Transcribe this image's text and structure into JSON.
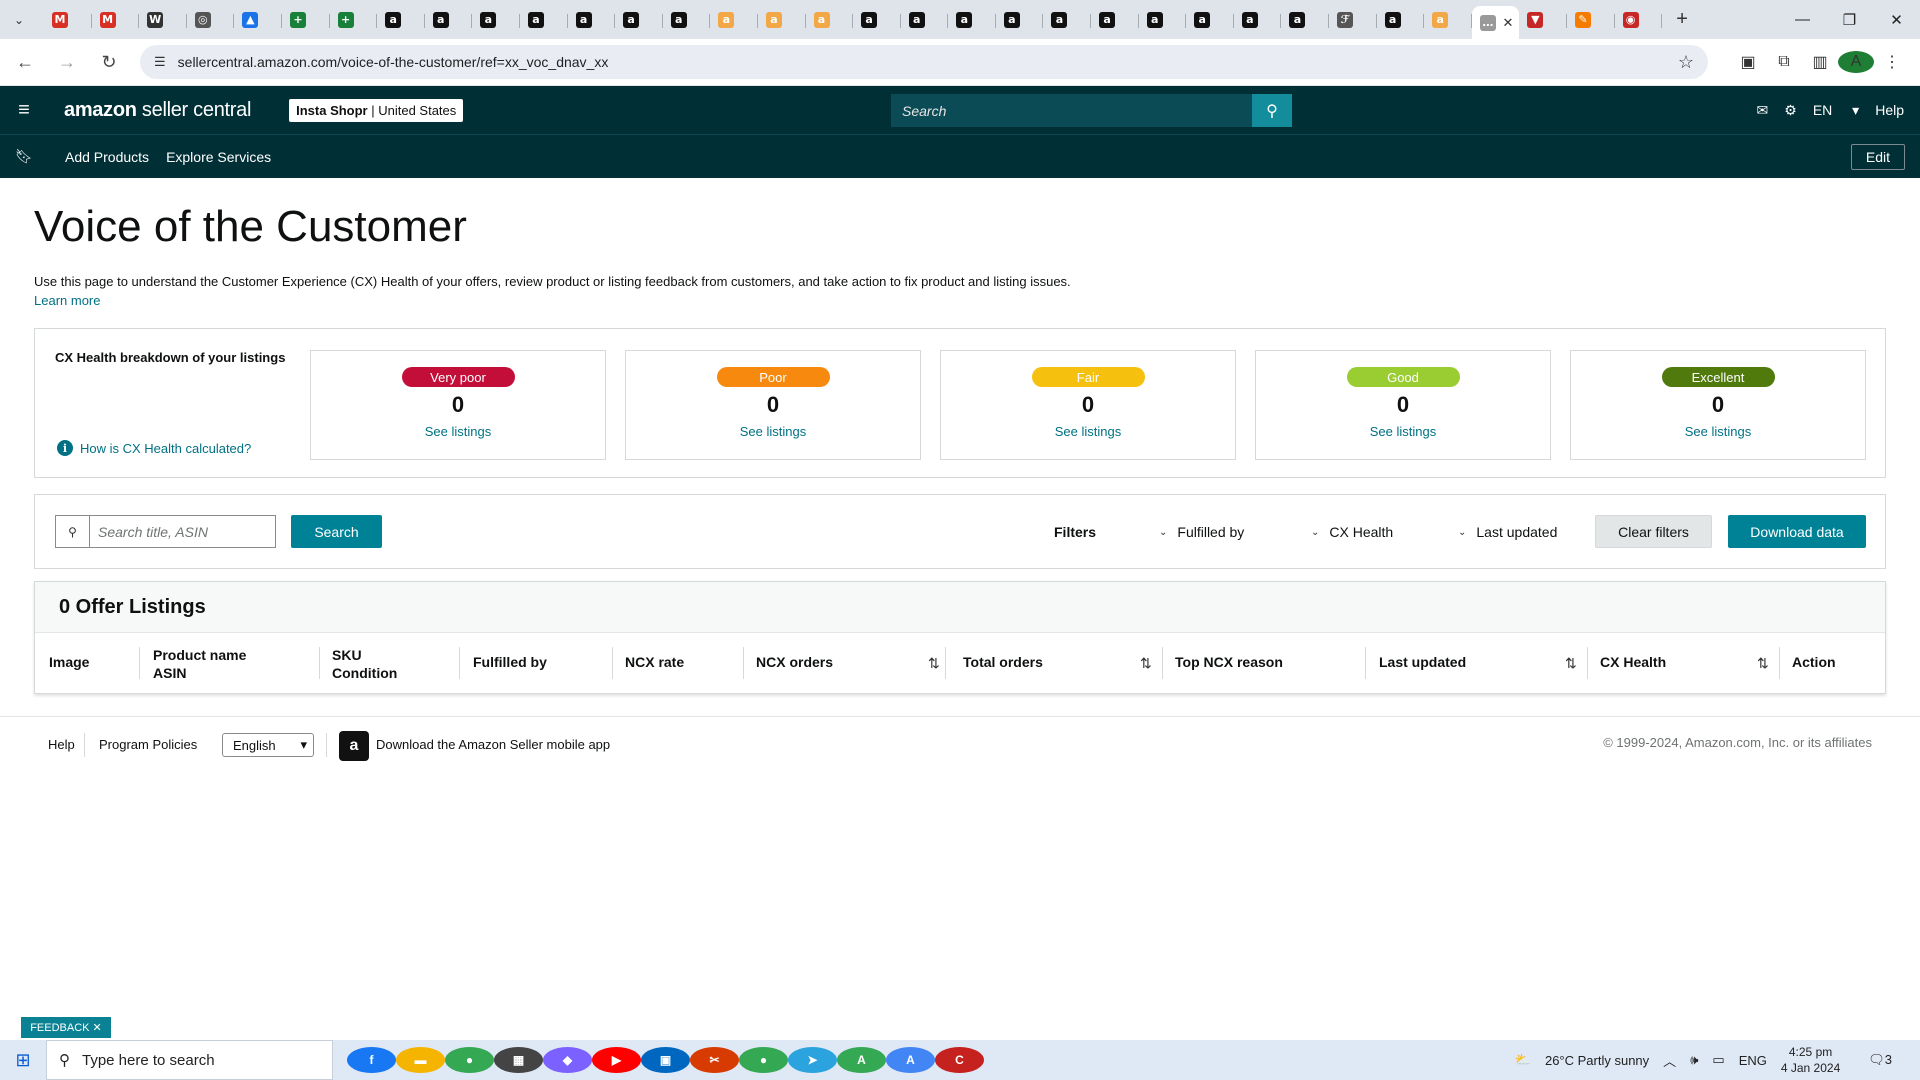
{
  "browser": {
    "url": "sellercentral.amazon.com/voice-of-the-customer/ref=xx_voc_dnav_xx",
    "tabs": [
      {
        "icon": "gmail-icon",
        "color": "#d93025",
        "glyph": "M"
      },
      {
        "icon": "gmail-icon",
        "color": "#d93025",
        "glyph": "M"
      },
      {
        "icon": "wix-icon",
        "color": "#333333",
        "glyph": "W"
      },
      {
        "icon": "globe-icon",
        "color": "#555555",
        "glyph": "◎"
      },
      {
        "icon": "drive-icon",
        "color": "#1a73e8",
        "glyph": "▲"
      },
      {
        "icon": "sheets-icon",
        "color": "#188038",
        "glyph": "+"
      },
      {
        "icon": "sheets-icon",
        "color": "#188038",
        "glyph": "+"
      },
      {
        "icon": "amazon-icon",
        "color": "#111111",
        "glyph": "a"
      },
      {
        "icon": "amazon-icon",
        "color": "#111111",
        "glyph": "a"
      },
      {
        "icon": "amazon-icon",
        "color": "#111111",
        "glyph": "a"
      },
      {
        "icon": "amazon-icon",
        "color": "#111111",
        "glyph": "a"
      },
      {
        "icon": "amazon-icon",
        "color": "#111111",
        "glyph": "a"
      },
      {
        "icon": "amazon-icon",
        "color": "#111111",
        "glyph": "a"
      },
      {
        "icon": "amazon-icon",
        "color": "#111111",
        "glyph": "a"
      },
      {
        "icon": "amazon-smile-icon",
        "color": "#f3a847",
        "glyph": "a"
      },
      {
        "icon": "amazon-smile-icon",
        "color": "#f3a847",
        "glyph": "a"
      },
      {
        "icon": "amazon-smile-icon",
        "color": "#f3a847",
        "glyph": "a"
      },
      {
        "icon": "amazon-icon",
        "color": "#111111",
        "glyph": "a"
      },
      {
        "icon": "amazon-icon",
        "color": "#111111",
        "glyph": "a"
      },
      {
        "icon": "amazon-icon",
        "color": "#111111",
        "glyph": "a"
      },
      {
        "icon": "amazon-icon",
        "color": "#111111",
        "glyph": "a"
      },
      {
        "icon": "amazon-icon",
        "color": "#111111",
        "glyph": "a"
      },
      {
        "icon": "amazon-icon",
        "color": "#111111",
        "glyph": "a"
      },
      {
        "icon": "amazon-icon",
        "color": "#111111",
        "glyph": "a"
      },
      {
        "icon": "amazon-icon",
        "color": "#111111",
        "glyph": "a"
      },
      {
        "icon": "amazon-icon",
        "color": "#111111",
        "glyph": "a"
      },
      {
        "icon": "amazon-icon",
        "color": "#111111",
        "glyph": "a"
      },
      {
        "icon": "script-icon",
        "color": "#555555",
        "glyph": "ℱ"
      },
      {
        "icon": "amazon-icon",
        "color": "#111111",
        "glyph": "a"
      },
      {
        "icon": "amazon-smile-icon",
        "color": "#f3a847",
        "glyph": "a"
      },
      {
        "icon": "loading-icon",
        "color": "#999999",
        "glyph": "…",
        "active": true
      },
      {
        "icon": "shield-icon",
        "color": "#c62828",
        "glyph": "▼"
      },
      {
        "icon": "pen-icon",
        "color": "#f57c00",
        "glyph": "✎"
      },
      {
        "icon": "record-icon",
        "color": "#c62828",
        "glyph": "◉"
      }
    ]
  },
  "header": {
    "logo_bold": "amazon",
    "logo_rest": " seller central",
    "merchant_name": "Insta Shopr",
    "merchant_region": " | United States",
    "search_placeholder": "Search",
    "lang": "EN",
    "help": "Help"
  },
  "subnav": {
    "items": [
      "Add Products",
      "Explore Services"
    ],
    "edit": "Edit"
  },
  "page": {
    "title": "Voice of the Customer",
    "description": "Use this page to understand the Customer Experience (CX) Health of your offers, review product or listing feedback from customers, and take action to fix product and listing issues.",
    "learn_more": "Learn more"
  },
  "cx_health": {
    "title": "CX Health breakdown of your listings",
    "how_link": "How is CX Health calculated?",
    "categories": [
      {
        "label": "Very poor",
        "count": "0",
        "link": "See listings",
        "color": "#c40e3a"
      },
      {
        "label": "Poor",
        "count": "0",
        "link": "See listings",
        "color": "#f78a0e"
      },
      {
        "label": "Fair",
        "count": "0",
        "link": "See listings",
        "color": "#f5c10e"
      },
      {
        "label": "Good",
        "count": "0",
        "link": "See listings",
        "color": "#9acd32"
      },
      {
        "label": "Excellent",
        "count": "0",
        "link": "See listings",
        "color": "#507a0b"
      }
    ]
  },
  "filters": {
    "search_placeholder": "Search title, ASIN",
    "search_button": "Search",
    "filters_label": "Filters",
    "dropdowns": [
      "Fulfilled by",
      "CX Health",
      "Last updated"
    ],
    "clear_button": "Clear filters",
    "download_button": "Download data"
  },
  "listings": {
    "heading": "0 Offer Listings",
    "columns": [
      {
        "line1": "Image"
      },
      {
        "line1": "Product name",
        "line2": "ASIN"
      },
      {
        "line1": "SKU",
        "line2": "Condition"
      },
      {
        "line1": "Fulfilled by"
      },
      {
        "line1": "NCX rate"
      },
      {
        "line1": "NCX orders",
        "sortable": true
      },
      {
        "line1": "Total orders",
        "sortable": true
      },
      {
        "line1": "Top NCX reason"
      },
      {
        "line1": "Last updated",
        "sortable": true
      },
      {
        "line1": "CX Health",
        "sortable": true
      },
      {
        "line1": "Action"
      }
    ]
  },
  "footer": {
    "help": "Help",
    "policies": "Program Policies",
    "language": "English",
    "app_link": "Download the Amazon Seller mobile app",
    "copyright": "© 1999-2024, Amazon.com, Inc. or its affiliates"
  },
  "feedback": "FEEDBACK",
  "taskbar": {
    "search_placeholder": "Type here to search",
    "weather": "26°C  Partly sunny",
    "lang": "ENG",
    "time": "4:25 pm",
    "date": "4 Jan 2024",
    "notifications": "3",
    "apps": [
      {
        "icon": "facebook-icon",
        "color": "#1877f2",
        "glyph": "f"
      },
      {
        "icon": "file-explorer-icon",
        "color": "#f4b400",
        "glyph": "▬"
      },
      {
        "icon": "chrome-icon",
        "color": "#34a853",
        "glyph": "●"
      },
      {
        "icon": "calculator-icon",
        "color": "#444444",
        "glyph": "▦"
      },
      {
        "icon": "copilot-icon",
        "color": "#7b61ff",
        "glyph": "◆"
      },
      {
        "icon": "youtube-icon",
        "color": "#ff0000",
        "glyph": "▶"
      },
      {
        "icon": "store-icon",
        "color": "#0067c0",
        "glyph": "▣"
      },
      {
        "icon": "snipping-tool-icon",
        "color": "#d83b01",
        "glyph": "✂"
      },
      {
        "icon": "chrome-icon",
        "color": "#34a853",
        "glyph": "●"
      },
      {
        "icon": "telegram-icon",
        "color": "#2aa3df",
        "glyph": "➤"
      },
      {
        "icon": "chrome-icon",
        "color": "#34a853",
        "glyph": "A"
      },
      {
        "icon": "chrome-icon",
        "color": "#4285f4",
        "glyph": "A"
      },
      {
        "icon": "chrome-icon",
        "color": "#c5221f",
        "glyph": "C"
      }
    ]
  }
}
